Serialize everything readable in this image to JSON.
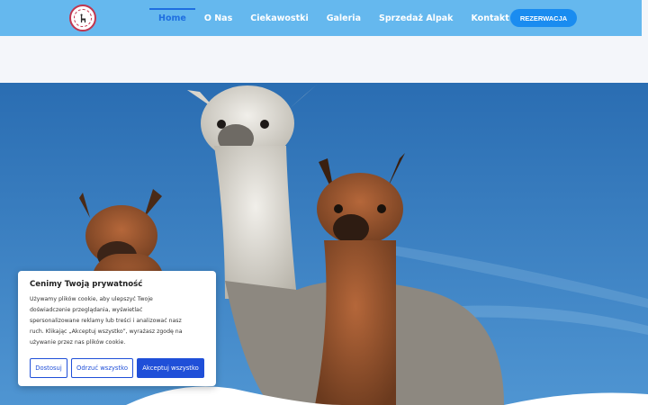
{
  "header": {
    "logo_icon": "alpaca-logo-icon",
    "nav": [
      {
        "label": "Home",
        "active": true
      },
      {
        "label": "O Nas",
        "active": false
      },
      {
        "label": "Ciekawostki",
        "active": false
      },
      {
        "label": "Galeria",
        "active": false
      },
      {
        "label": "Sprzedaż Alpak",
        "active": false
      },
      {
        "label": "Kontakt",
        "active": false
      }
    ],
    "reserve_label": "REZERWACJA"
  },
  "cookie": {
    "title": "Cenimy Twoją prywatność",
    "lines": [
      "Używamy plików cookie, aby ulepszyć Twoje",
      "doświadczenie przeglądania, wyświetlać",
      "spersonalizowane reklamy lub treści i analizować nasz",
      "ruch. Klikając „Akceptuj wszystko”, wyrażasz zgodę na",
      "używanie przez nas plików cookie."
    ],
    "customize_label": "Dostosuj",
    "reject_label": "Odrzuć wszystko",
    "accept_label": "Akceptuj wszystko"
  },
  "colors": {
    "header_bg": "#65b8ee",
    "active_nav": "#1f6fe0",
    "reserve_bg": "#1a8cf0",
    "cookie_accent": "#1f4fd8"
  }
}
